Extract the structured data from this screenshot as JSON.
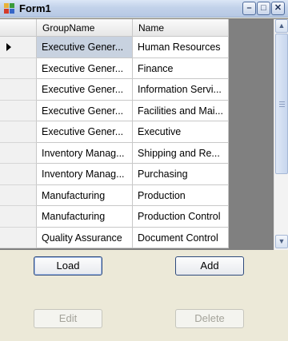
{
  "window": {
    "title": "Form1",
    "minimize_glyph": "–",
    "maximize_glyph": "□",
    "close_glyph": "✕"
  },
  "grid": {
    "columns": [
      "GroupName",
      "Name"
    ],
    "rows": [
      [
        "Executive Gener...",
        "Human Resources"
      ],
      [
        "Executive Gener...",
        "Finance"
      ],
      [
        "Executive Gener...",
        "Information Servi..."
      ],
      [
        "Executive Gener...",
        "Facilities and Mai..."
      ],
      [
        "Executive Gener...",
        "Executive"
      ],
      [
        "Inventory Manag...",
        "Shipping and Re..."
      ],
      [
        "Inventory Manag...",
        "Purchasing"
      ],
      [
        "Manufacturing",
        "Production"
      ],
      [
        "Manufacturing",
        "Production Control"
      ],
      [
        "Quality Assurance",
        "Document Control"
      ]
    ],
    "scroll_up_glyph": "▲",
    "scroll_down_glyph": "▼"
  },
  "buttons": {
    "load": "Load",
    "add": "Add",
    "edit": "Edit",
    "delete": "Delete"
  },
  "colors": {
    "selected_cell": "#c8d2e0",
    "grid_bg": "#808080",
    "form_bg": "#ece9d8"
  }
}
